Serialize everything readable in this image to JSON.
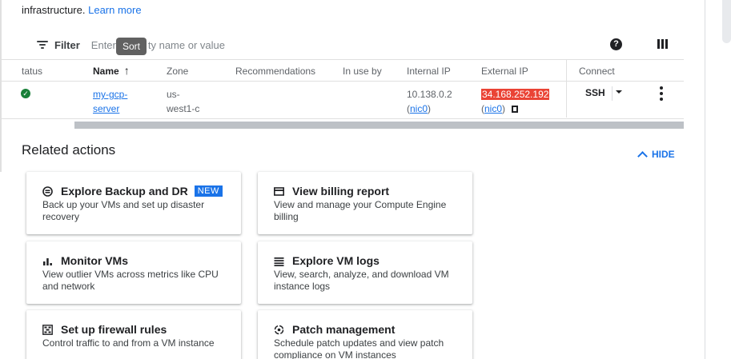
{
  "intro": {
    "text": "infrastructure.",
    "learn_more": "Learn more"
  },
  "filter": {
    "label": "Filter",
    "placeholder": "Enter property name or value",
    "visible_prefix": "Enter",
    "visible_suffix": "ty name or value"
  },
  "tooltip": {
    "text": "Sort"
  },
  "table": {
    "headers": {
      "status": "tatus",
      "name": "Name",
      "zone": "Zone",
      "recommendations": "Recommendations",
      "in_use_by": "In use by",
      "internal_ip": "Internal IP",
      "external_ip": "External IP",
      "connect": "Connect"
    },
    "row": {
      "name_line1": "my-gcp-",
      "name_line2": "server",
      "zone_line1": "us-",
      "zone_line2": "west1-c",
      "internal_ip": "10.138.0.2",
      "internal_nic": "nic0",
      "external_ip": "34.168.252.192",
      "external_nic": "nic0",
      "connect": "SSH"
    }
  },
  "related": {
    "title": "Related actions",
    "hide": "HIDE",
    "cards": [
      {
        "title": "Explore Backup and DR",
        "badge": "NEW",
        "desc": "Back up your VMs and set up disaster recovery",
        "icon": "backup-icon"
      },
      {
        "title": "View billing report",
        "desc": "View and manage your Compute Engine billing",
        "icon": "billing-icon"
      },
      {
        "title": "Monitor VMs",
        "desc": "View outlier VMs across metrics like CPU and network",
        "icon": "monitor-icon"
      },
      {
        "title": "Explore VM logs",
        "desc": "View, search, analyze, and download VM instance logs",
        "icon": "logs-icon"
      },
      {
        "title": "Set up firewall rules",
        "desc": "Control traffic to and from a VM instance",
        "icon": "firewall-icon"
      },
      {
        "title": "Patch management",
        "desc": "Schedule patch updates and view patch compliance on VM instances",
        "icon": "patch-icon"
      }
    ]
  },
  "colors": {
    "link": "#1a73e8",
    "status_ok": "#188038",
    "highlight": "#ea4335"
  }
}
